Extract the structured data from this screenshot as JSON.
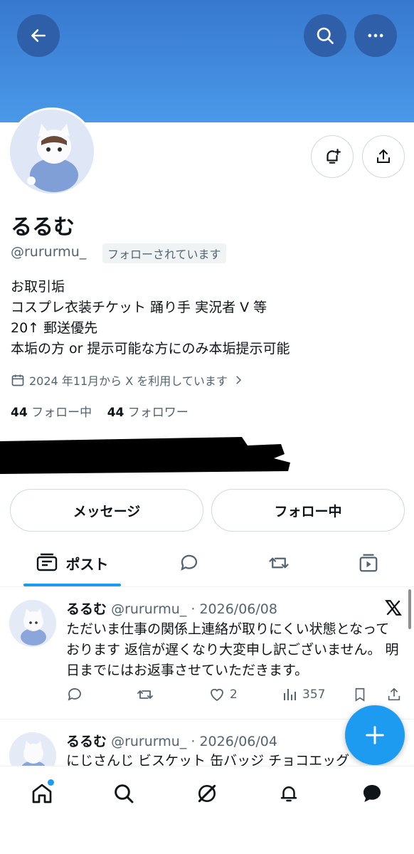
{
  "profile": {
    "display_name": "るるむ",
    "handle": "@rururmu_",
    "follows_you_badge": "フォローされています",
    "bio_lines": [
      "お取引垢",
      "コスプレ衣装チケット 踊り手 実況者 V 等",
      "20↑ 郵送優先",
      "本垢の方 or 提示可能な方にのみ本垢提示可能"
    ],
    "joined_text": "2024 年11月から X を利用しています",
    "following_count": "44",
    "following_label": "フォロー中",
    "followers_count": "44",
    "followers_label": "フォロワー"
  },
  "buttons": {
    "message": "メッセージ",
    "following": "フォロー中"
  },
  "tabs": [
    {
      "label": "ポスト",
      "icon": "post-icon",
      "active": true
    },
    {
      "label": "",
      "icon": "replies-icon"
    },
    {
      "label": "",
      "icon": "repost-icon"
    },
    {
      "label": "",
      "icon": "media-icon"
    }
  ],
  "posts": [
    {
      "name": "るるむ",
      "handle": "@rururmu_",
      "date": "· 2026/06/08",
      "text": "ただいま仕事の関係上連絡が取りにくい状態となっております 返信が遅くなり大変申し訳ございません。 明日までにはお返事させていただきます。",
      "replies": "",
      "reposts": "",
      "likes": "2",
      "views": "357"
    },
    {
      "name": "るるむ",
      "handle": "@rururmu_",
      "date": "· 2026/06/04",
      "text": "にじさんじ ビスケット 缶バッジ チョコエッグ"
    }
  ],
  "icons": {
    "back": "back-arrow-icon",
    "search": "search-icon",
    "more": "more-icon",
    "notify": "bell-plus-icon",
    "share": "share-icon",
    "calendar": "calendar-icon",
    "chevron": "chevron-right-icon",
    "fab": "plus-icon",
    "nav": [
      "home-icon",
      "search-icon",
      "grok-icon",
      "bell-icon",
      "messages-icon"
    ]
  },
  "colors": {
    "accent": "#1d9bf0",
    "banner_top": "#3779cf",
    "banner_bottom": "#4a98e8",
    "secondary_text": "#536471"
  }
}
